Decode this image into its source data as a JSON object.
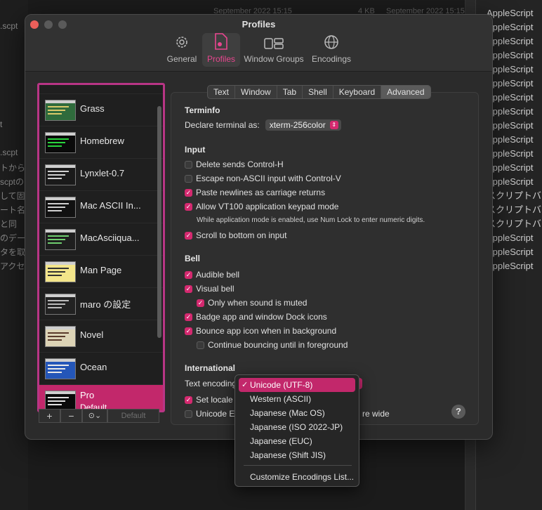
{
  "background": {
    "left_fragments": [
      ".scpt",
      "t",
      ".scpt",
      "トから",
      "scptの",
      "して固",
      "ート名",
      "と同",
      "のデー",
      "タを取",
      "アクセ"
    ],
    "top_fragments": [
      "September 2022 15:15",
      "4 KB",
      "September 2022 15:15"
    ],
    "right_rows": [
      "AppleScript",
      "AppleScript",
      "AppleScript",
      "AppleScript",
      "AppleScript",
      "AppleScript",
      "AppleScript",
      "AppleScript",
      "AppleScript",
      "AppleScript",
      "AppleScript",
      "AppleScript",
      "AppleScript",
      "スクリプトバン",
      "スクリプトバン",
      "スクリプトバン",
      "AppleScript",
      "AppleScript",
      "AppleScript"
    ]
  },
  "window": {
    "title": "Profiles",
    "toolbar": [
      {
        "label": "General",
        "icon": "gear-icon"
      },
      {
        "label": "Profiles",
        "icon": "profile-doc-icon"
      },
      {
        "label": "Window Groups",
        "icon": "window-groups-icon"
      },
      {
        "label": "Encodings",
        "icon": "globe-icon"
      }
    ],
    "active_toolbar": "Profiles"
  },
  "profiles": [
    {
      "name": "Grass",
      "bg": "#2f6b3c",
      "fg": "#d9c96a"
    },
    {
      "name": "Homebrew",
      "bg": "#0a0a0a",
      "fg": "#28d43c"
    },
    {
      "name": "Lynxlet-0.7",
      "bg": "#1a1a1a",
      "fg": "#d0d0d0"
    },
    {
      "name": "Mac ASCII In...",
      "bg": "#111111",
      "fg": "#cfcfcf"
    },
    {
      "name": "MacAsciiqua...",
      "bg": "#1e1e1e",
      "fg": "#6fcf6f"
    },
    {
      "name": "Man Page",
      "bg": "#f3e58a",
      "fg": "#333333"
    },
    {
      "name": "maro の設定",
      "bg": "#222222",
      "fg": "#bbbbbb"
    },
    {
      "name": "Novel",
      "bg": "#ddd4b6",
      "fg": "#5a3a2a"
    },
    {
      "name": "Ocean",
      "bg": "#2456b8",
      "fg": "#e8e8e8"
    },
    {
      "name": "Pro",
      "bg": "#0a0a0a",
      "fg": "#e0e0e0",
      "sub": "Default",
      "selected": true
    }
  ],
  "list_toolbar": {
    "add": "+",
    "remove": "−",
    "more": "⊙⌄",
    "default": "Default"
  },
  "tabs": [
    "Text",
    "Window",
    "Tab",
    "Shell",
    "Keyboard",
    "Advanced"
  ],
  "active_tab": "Advanced",
  "terminfo": {
    "section": "Terminfo",
    "declare_label": "Declare terminal as:",
    "declare_value": "xterm-256color"
  },
  "input": {
    "section": "Input",
    "delete_ctrl_h": {
      "label": "Delete sends Control-H",
      "checked": false
    },
    "escape_non_ascii": {
      "label": "Escape non-ASCII input with Control-V",
      "checked": false
    },
    "paste_newlines": {
      "label": "Paste newlines as carriage returns",
      "checked": true
    },
    "vt100_keypad": {
      "label": "Allow VT100 application keypad mode",
      "checked": true
    },
    "vt100_hint": "While application mode is enabled, use Num Lock to enter numeric digits.",
    "scroll_bottom": {
      "label": "Scroll to bottom on input",
      "checked": true
    }
  },
  "bell": {
    "section": "Bell",
    "audible": {
      "label": "Audible bell",
      "checked": true
    },
    "visual": {
      "label": "Visual bell",
      "checked": true
    },
    "only_muted": {
      "label": "Only when sound is muted",
      "checked": true
    },
    "badge": {
      "label": "Badge app and window Dock icons",
      "checked": true
    },
    "bounce": {
      "label": "Bounce app icon when in background",
      "checked": true
    },
    "continue_bounce": {
      "label": "Continue bouncing until in foreground",
      "checked": false
    }
  },
  "international": {
    "section": "International",
    "encoding_label": "Text encoding",
    "set_locale": {
      "label": "Set locale",
      "checked": true
    },
    "unicode_east": {
      "label": "Unicode Ea",
      "checked": false
    },
    "unicode_east_tail": "re wide"
  },
  "encoding_menu": {
    "items": [
      {
        "label": "Unicode (UTF-8)",
        "selected": true
      },
      {
        "label": "Western (ASCII)"
      },
      {
        "label": "Japanese (Mac OS)"
      },
      {
        "label": "Japanese (ISO 2022-JP)"
      },
      {
        "label": "Japanese (EUC)"
      },
      {
        "label": "Japanese (Shift JIS)"
      }
    ],
    "customize": "Customize Encodings List..."
  },
  "help": "?"
}
